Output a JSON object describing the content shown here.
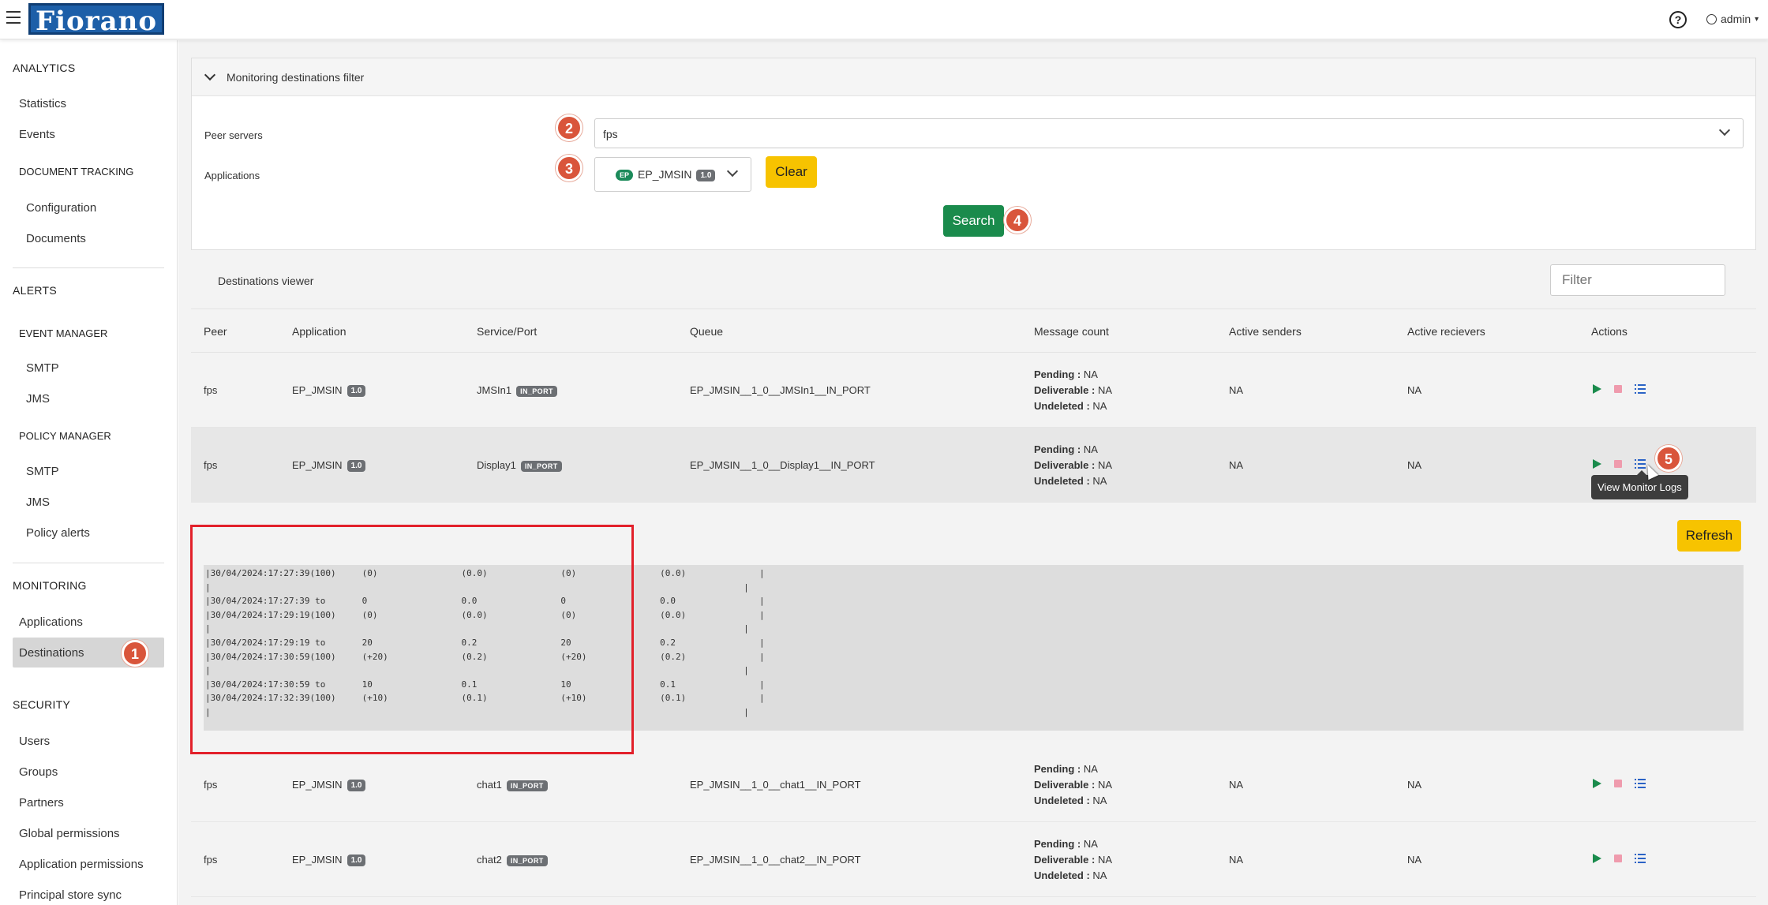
{
  "header": {
    "logo": "Fiorano",
    "user": "admin"
  },
  "sidebar": {
    "analytics": "ANALYTICS",
    "statistics": "Statistics",
    "events": "Events",
    "doc_tracking": "DOCUMENT TRACKING",
    "configuration": "Configuration",
    "documents": "Documents",
    "alerts": "ALERTS",
    "event_manager": "EVENT MANAGER",
    "em_smtp": "SMTP",
    "em_jms": "JMS",
    "policy_manager": "POLICY MANAGER",
    "pm_smtp": "SMTP",
    "pm_jms": "JMS",
    "policy_alerts": "Policy alerts",
    "monitoring": "MONITORING",
    "applications": "Applications",
    "destinations": "Destinations",
    "security": "SECURITY",
    "users": "Users",
    "groups": "Groups",
    "partners": "Partners",
    "global_permissions": "Global permissions",
    "application_permissions": "Application permissions",
    "principal_store_sync": "Principal store sync"
  },
  "filter": {
    "title": "Monitoring destinations filter",
    "peer_label": "Peer servers",
    "peer_value": "fps",
    "apps_label": "Applications",
    "app_badge": "EP",
    "app_name": "EP_JMSIN",
    "app_version": "1.0",
    "clear": "Clear",
    "search": "Search"
  },
  "steps": [
    "1",
    "2",
    "3",
    "4",
    "5"
  ],
  "viewer": {
    "title": "Destinations viewer",
    "filter_placeholder": "Filter",
    "columns": [
      "Peer",
      "Application",
      "Service/Port",
      "Queue",
      "Message count",
      "Active senders",
      "Active recievers",
      "Actions"
    ],
    "pending_label": "Pending :",
    "deliverable_label": "Deliverable :",
    "undeleted_label": "Undeleted :",
    "rows": [
      {
        "peer": "fps",
        "app": "EP_JMSIN",
        "ver": "1.0",
        "service": "JMSIn1",
        "port": "IN_PORT",
        "queue": "EP_JMSIN__1_0__JMSIn1__IN_PORT",
        "pending": "NA",
        "deliverable": "NA",
        "undeleted": "NA",
        "senders": "NA",
        "receivers": "NA"
      },
      {
        "peer": "fps",
        "app": "EP_JMSIN",
        "ver": "1.0",
        "service": "Display1",
        "port": "IN_PORT",
        "queue": "EP_JMSIN__1_0__Display1__IN_PORT",
        "pending": "NA",
        "deliverable": "NA",
        "undeleted": "NA",
        "senders": "NA",
        "receivers": "NA"
      },
      {
        "peer": "fps",
        "app": "EP_JMSIN",
        "ver": "1.0",
        "service": "chat1",
        "port": "IN_PORT",
        "queue": "EP_JMSIN__1_0__chat1__IN_PORT",
        "pending": "NA",
        "deliverable": "NA",
        "undeleted": "NA",
        "senders": "NA",
        "receivers": "NA"
      },
      {
        "peer": "fps",
        "app": "EP_JMSIN",
        "ver": "1.0",
        "service": "chat2",
        "port": "IN_PORT",
        "queue": "EP_JMSIN__1_0__chat2__IN_PORT",
        "pending": "NA",
        "deliverable": "NA",
        "undeleted": "NA",
        "senders": "NA",
        "receivers": "NA"
      }
    ],
    "tooltip": "View Monitor Logs",
    "refresh": "Refresh"
  },
  "logs": "|30/04/2024:17:27:39(100)     (0)                (0.0)              (0)                (0.0)              |\n|                                                                                                      |\n|30/04/2024:17:27:39 to       0                  0.0                0                  0.0                |\n|30/04/2024:17:29:19(100)     (0)                (0.0)              (0)                (0.0)              |\n|                                                                                                      |\n|30/04/2024:17:29:19 to       20                 0.2                20                 0.2                |\n|30/04/2024:17:30:59(100)     (+20)              (0.2)              (+20)              (0.2)              |\n|                                                                                                      |\n|30/04/2024:17:30:59 to       10                 0.1                10                 0.1                |\n|30/04/2024:17:32:39(100)     (+10)              (0.1)              (+10)              (0.1)              |\n|                                                                                                      |"
}
